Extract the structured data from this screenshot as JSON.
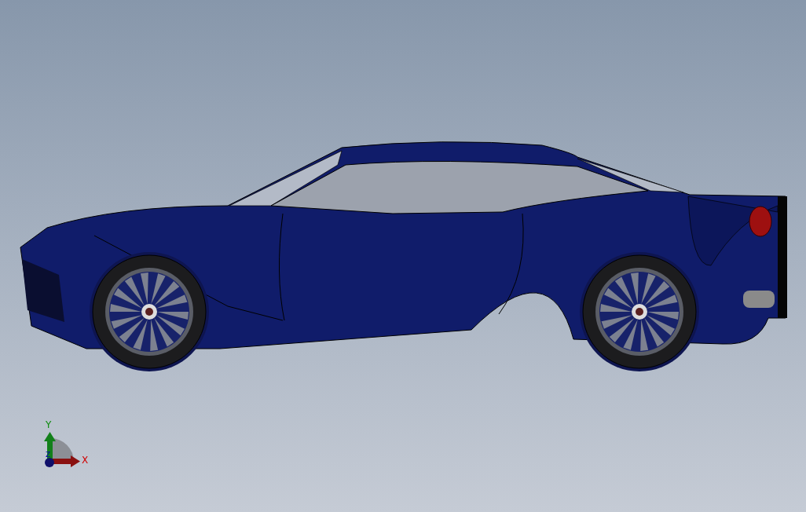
{
  "viewport": {
    "model": {
      "kind": "car"
    },
    "triad": {
      "axes": [
        {
          "kind": "vertical",
          "label": "Y"
        },
        {
          "kind": "depth",
          "label": "Z"
        },
        {
          "kind": "horizontal",
          "label": "X"
        }
      ]
    }
  }
}
